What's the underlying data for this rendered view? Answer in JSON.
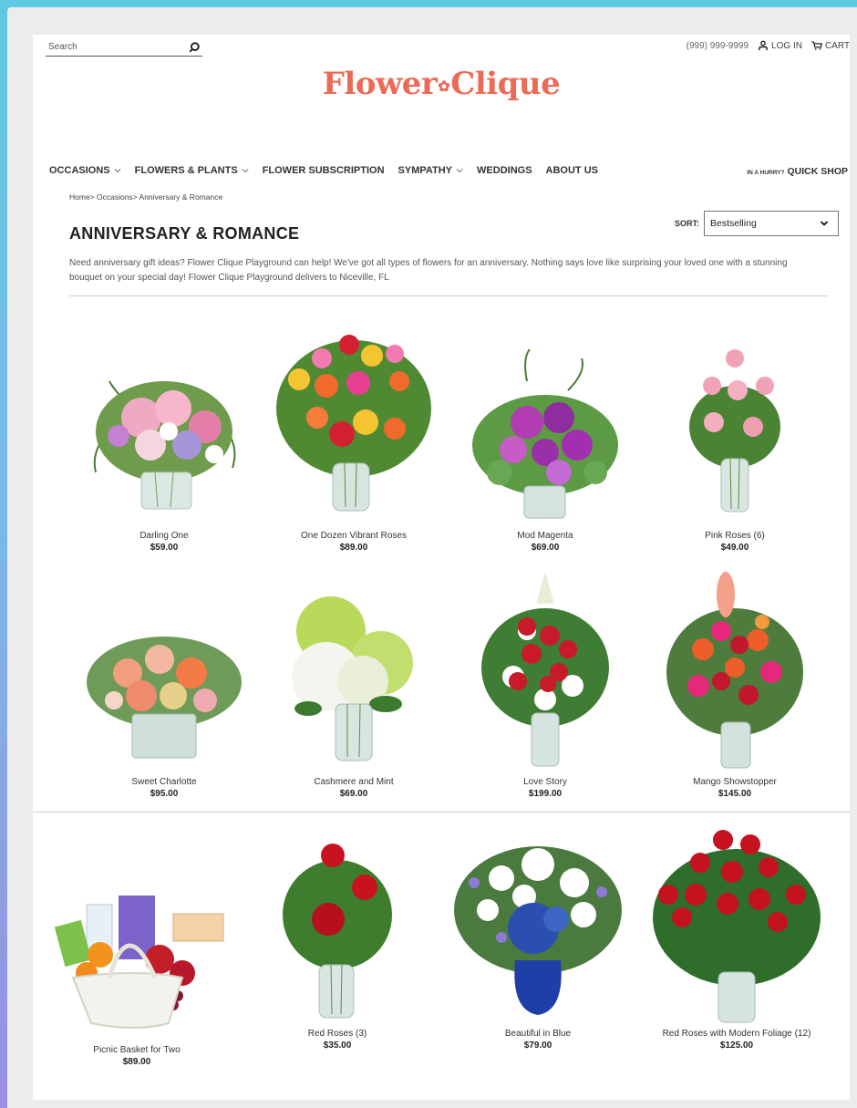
{
  "header": {
    "search_placeholder": "Search",
    "phone": "(999) 999-9999",
    "login_label": "LOG IN",
    "cart_label": "CART",
    "logo_left": "Flower",
    "logo_right": "Clique"
  },
  "nav": {
    "occasions": "OCCASIONS",
    "flowers_plants": "FLOWERS & PLANTS",
    "subscription": "FLOWER SUBSCRIPTION",
    "sympathy": "SYMPATHY",
    "weddings": "WEDDINGS",
    "about": "ABOUT US",
    "hurry": "IN A HURRY?",
    "quick_shop": "QUICK SHOP"
  },
  "breadcrumb": "Home> Occasions> Anniversary & Romance",
  "page_title": "ANNIVERSARY & ROMANCE",
  "sort": {
    "label": "SORT:",
    "value": "Bestselling"
  },
  "description": "Need anniversary gift ideas? Flower Clique Playground can help! We've got all types of flowers for an anniversary. Nothing says love like surprising your loved one with a stunning bouquet on your special day! Flower Clique Playground delivers to Niceville, FL",
  "products": [
    {
      "name": "Darling One",
      "price": "$59.00"
    },
    {
      "name": "One Dozen Vibrant Roses",
      "price": "$89.00"
    },
    {
      "name": "Mod Magenta",
      "price": "$69.00"
    },
    {
      "name": "Pink Roses (6)",
      "price": "$49.00"
    },
    {
      "name": "Sweet Charlotte",
      "price": "$95.00"
    },
    {
      "name": "Cashmere and Mint",
      "price": "$69.00"
    },
    {
      "name": "Love Story",
      "price": "$199.00"
    },
    {
      "name": "Mango Showstopper",
      "price": "$145.00"
    },
    {
      "name": "Picnic Basket for Two",
      "price": "$89.00"
    },
    {
      "name": "Red Roses (3)",
      "price": "$35.00"
    },
    {
      "name": "Beautiful in Blue",
      "price": "$79.00"
    },
    {
      "name": "Red Roses with Modern Foliage (12)",
      "price": "$125.00"
    }
  ]
}
